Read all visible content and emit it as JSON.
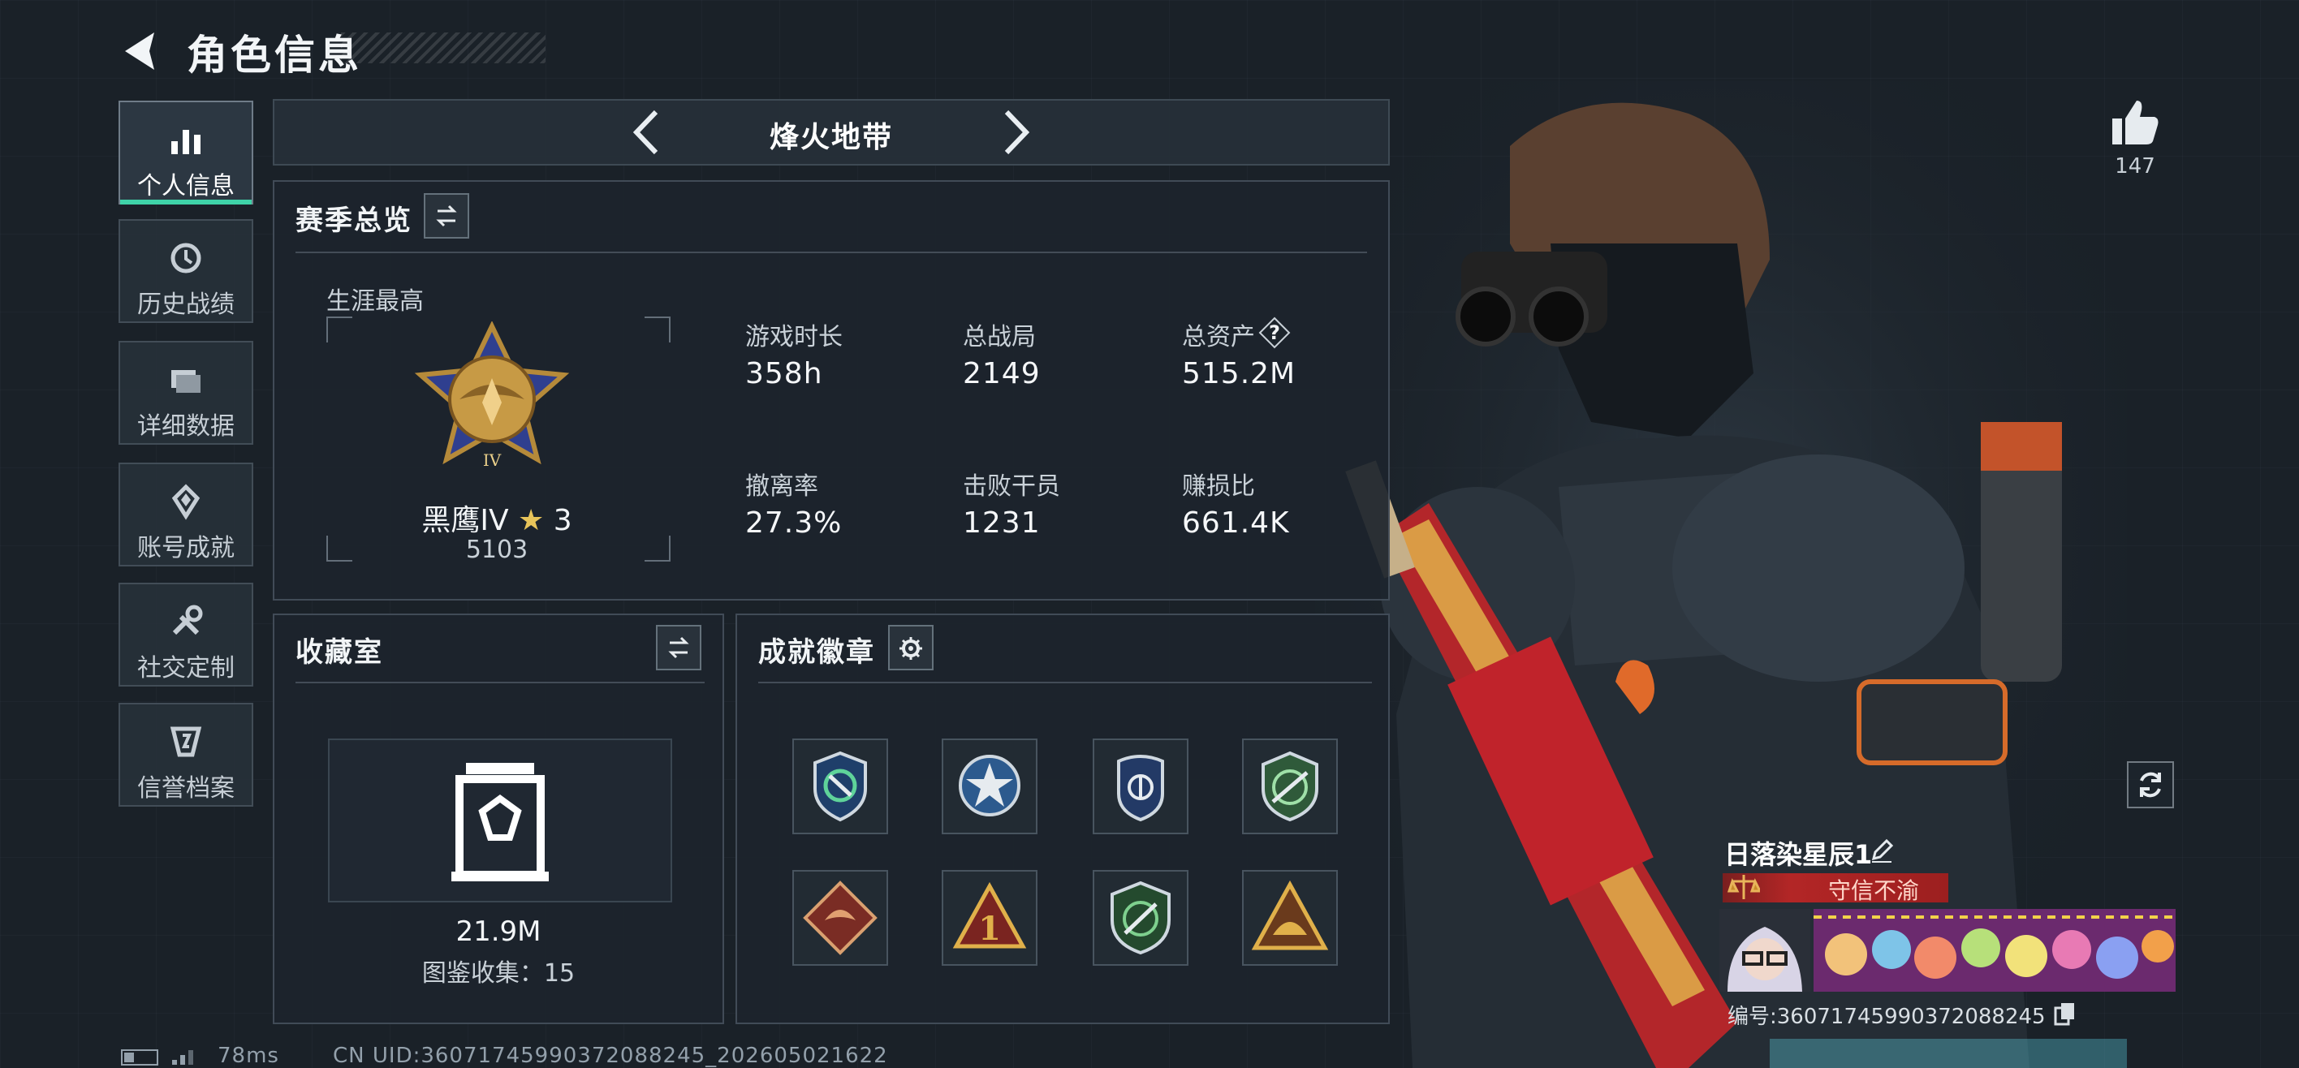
{
  "header": {
    "title": "角色信息"
  },
  "sidebar": {
    "items": [
      {
        "label": "个人信息",
        "icon": "bar-chart-icon",
        "active": true
      },
      {
        "label": "历史战绩",
        "icon": "history-icon"
      },
      {
        "label": "详细数据",
        "icon": "data-folder-icon"
      },
      {
        "label": "账号成就",
        "icon": "achievement-icon"
      },
      {
        "label": "社交定制",
        "icon": "tools-icon"
      },
      {
        "label": "信誉档案",
        "icon": "credit-shield-icon"
      }
    ]
  },
  "mode_tab": {
    "label": "烽火地带"
  },
  "season": {
    "title": "赛季总览",
    "career_label": "生涯最高",
    "rank": {
      "name": "黑鹰IV",
      "stars": "3",
      "score": "5103"
    },
    "stats": [
      {
        "label": "游戏时长",
        "value": "358h"
      },
      {
        "label": "总战局",
        "value": "2149"
      },
      {
        "label": "总资产",
        "value": "515.2M"
      },
      {
        "label": "撤离率",
        "value": "27.3%"
      },
      {
        "label": "击败干员",
        "value": "1231"
      },
      {
        "label": "赚损比",
        "value": "661.4K"
      }
    ]
  },
  "collection": {
    "title": "收藏室",
    "value": "21.9M",
    "catalog_label": "图鉴收集：",
    "catalog_count": "15"
  },
  "badges": {
    "title": "成就徽章",
    "items": [
      "shield-green-badge",
      "star-medal-badge",
      "police-badge",
      "rifle-green-badge",
      "dragon-red-badge",
      "number-one-badge",
      "rifle-shield-badge",
      "helmet-triangle-badge"
    ]
  },
  "profile": {
    "likes": "147",
    "player_name": "日落染星辰1",
    "motto": "守信不渝",
    "id_line": "编号:36071745990372088245"
  },
  "footer": {
    "ping": "78ms",
    "uid": "CN UID:36071745990372088245_202605021622"
  },
  "colors": {
    "accent": "#3fd3a8",
    "background": "#1a2128",
    "motto_red": "#b32626"
  }
}
